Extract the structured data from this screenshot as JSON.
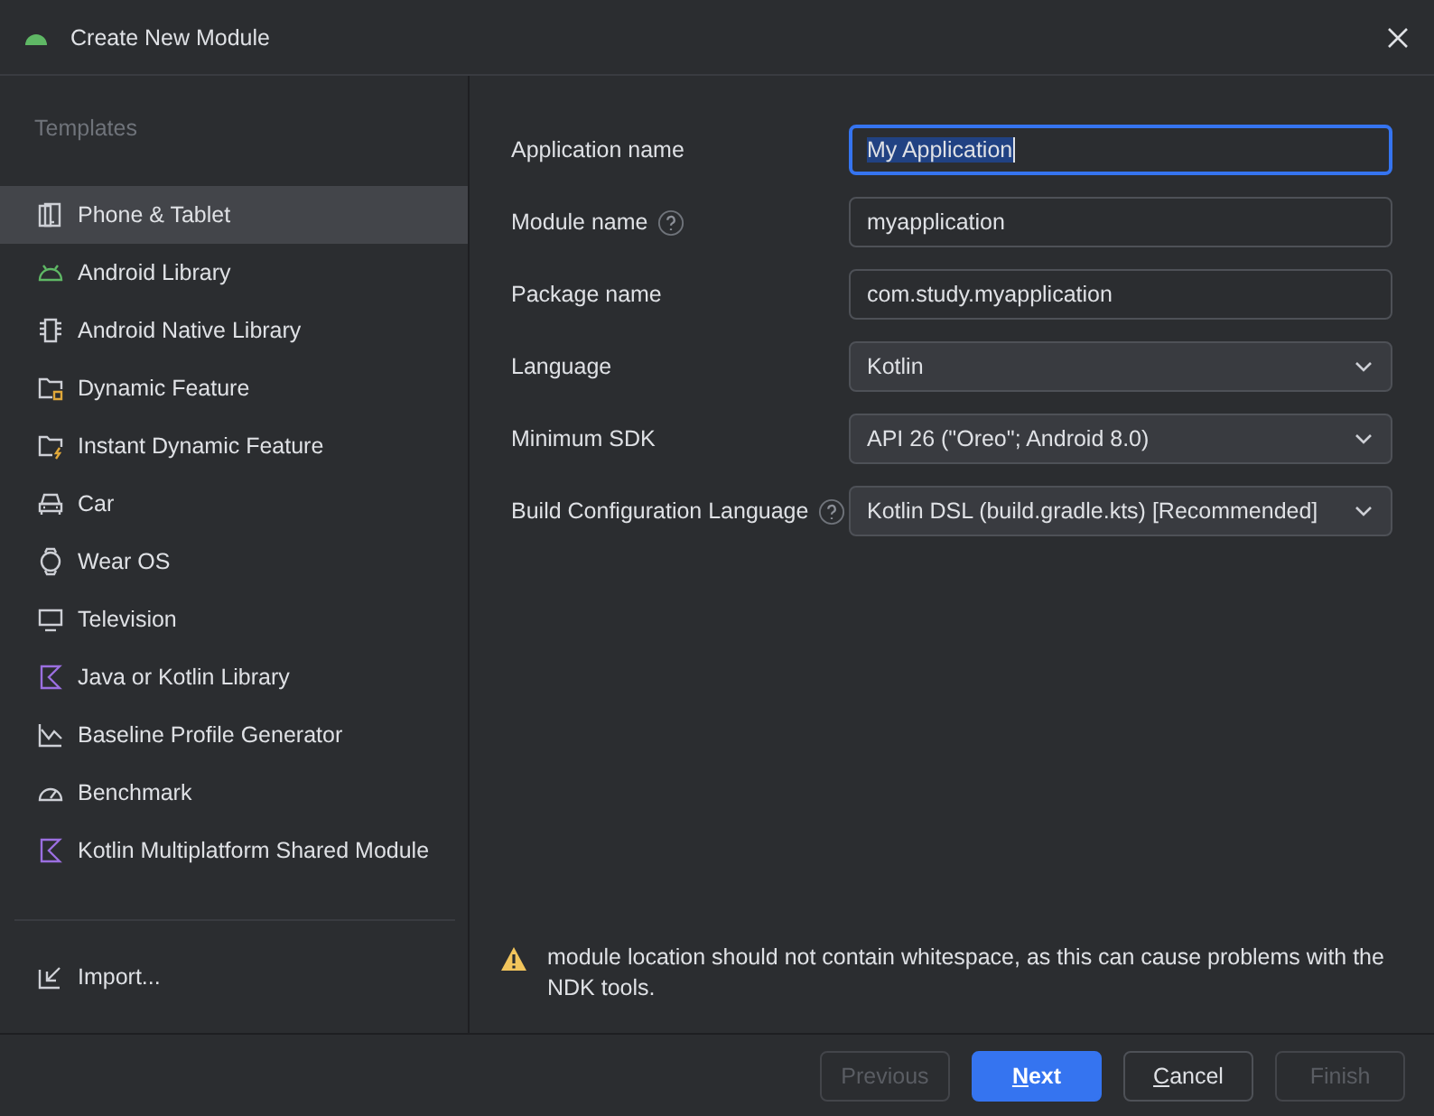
{
  "window": {
    "title": "Create New Module"
  },
  "sidebar": {
    "heading": "Templates",
    "items": [
      {
        "label": "Phone & Tablet",
        "selected": true
      },
      {
        "label": "Android Library",
        "selected": false
      },
      {
        "label": "Android Native Library",
        "selected": false
      },
      {
        "label": "Dynamic Feature",
        "selected": false
      },
      {
        "label": "Instant Dynamic Feature",
        "selected": false
      },
      {
        "label": "Car",
        "selected": false
      },
      {
        "label": "Wear OS",
        "selected": false
      },
      {
        "label": "Television",
        "selected": false
      },
      {
        "label": "Java or Kotlin Library",
        "selected": false
      },
      {
        "label": "Baseline Profile Generator",
        "selected": false
      },
      {
        "label": "Benchmark",
        "selected": false
      },
      {
        "label": "Kotlin Multiplatform Shared Module",
        "selected": false
      }
    ],
    "import": "Import..."
  },
  "form": [
    {
      "label": "Application name",
      "kind": "text",
      "value": "My Application",
      "help": false,
      "focused": true
    },
    {
      "label": "Module name",
      "kind": "text",
      "value": "myapplication",
      "help": true,
      "focused": false
    },
    {
      "label": "Package name",
      "kind": "text",
      "value": "com.study.myapplication",
      "help": false,
      "focused": false
    },
    {
      "label": "Language",
      "kind": "dropdown",
      "value": "Kotlin",
      "help": false,
      "focused": false
    },
    {
      "label": "Minimum SDK",
      "kind": "dropdown",
      "value": "API 26 (\"Oreo\"; Android 8.0)",
      "help": false,
      "focused": false
    },
    {
      "label": "Build Configuration Language",
      "kind": "dropdown",
      "value": "Kotlin DSL (build.gradle.kts) [Recommended]",
      "help": true,
      "focused": false
    }
  ],
  "warning": "module location should not contain whitespace, as this can cause problems with the NDK tools.",
  "buttons": [
    {
      "label": "Previous",
      "disabled": true,
      "primary": false,
      "mnemonic": false
    },
    {
      "label": "Next",
      "disabled": false,
      "primary": true,
      "mnemonic": true
    },
    {
      "label": "Cancel",
      "disabled": false,
      "primary": false,
      "mnemonic": true
    },
    {
      "label": "Finish",
      "disabled": true,
      "primary": false,
      "mnemonic": false
    }
  ]
}
